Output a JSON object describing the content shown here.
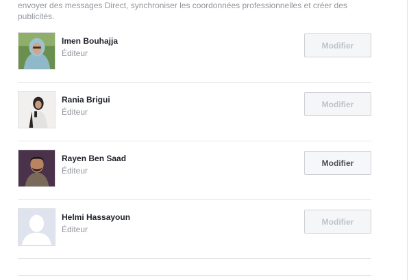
{
  "intro_text": "envoyer des messages Direct, synchroniser les coordonnées professionnelles et créer des publicités.",
  "members": [
    {
      "name": "Imen Bouhajja",
      "role": "Éditeur",
      "action_label": "Modifier",
      "action_enabled": false
    },
    {
      "name": "Rania Brigui",
      "role": "Éditeur",
      "action_label": "Modifier",
      "action_enabled": false
    },
    {
      "name": "Rayen Ben Saad",
      "role": "Éditeur",
      "action_label": "Modifier",
      "action_enabled": true
    },
    {
      "name": "Helmi Hassayoun",
      "role": "Éditeur",
      "action_label": "Modifier",
      "action_enabled": false
    }
  ]
}
